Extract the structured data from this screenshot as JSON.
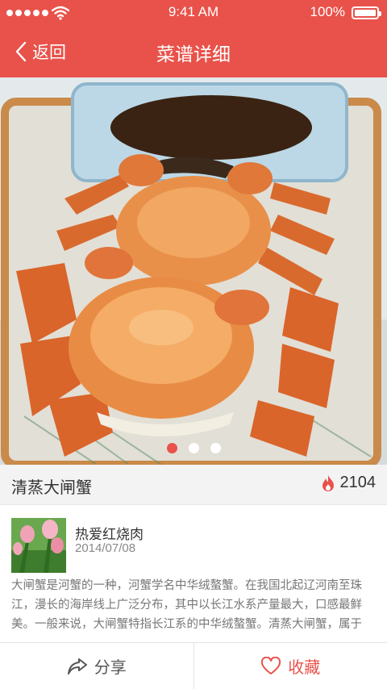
{
  "status_bar": {
    "time": "9:41 AM",
    "battery": "100%"
  },
  "nav": {
    "back_label": "返回",
    "title": "菜谱详细"
  },
  "carousel": {
    "page_count": 3,
    "active_index": 0
  },
  "dish": {
    "name": "清蒸大闸蟹",
    "views": "2104"
  },
  "author": {
    "name": "热爱红烧肉",
    "date": "2014/07/08"
  },
  "description": "大闸蟹是河蟹的一种，河蟹学名中华绒螯蟹。在我国北起辽河南至珠江，漫长的海岸线上广泛分布，其中以长江水系产量最大，口感最鲜美。一般来说，大闸蟹特指长江系的中华绒螯蟹。清蒸大闸蟹，属于",
  "actions": {
    "share_label": "分享",
    "favorite_label": "收藏"
  },
  "colors": {
    "accent": "#e8524a"
  },
  "icons": [
    "back-chevron-icon",
    "wifi-icon",
    "battery-icon",
    "flame-icon",
    "share-icon",
    "heart-icon"
  ]
}
